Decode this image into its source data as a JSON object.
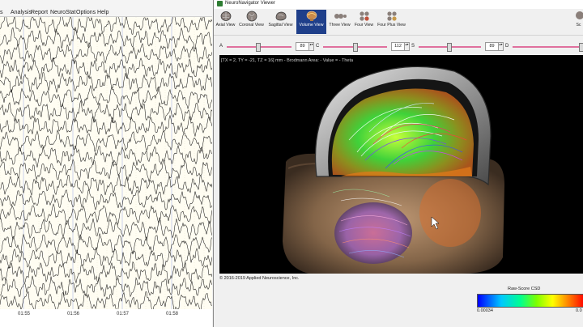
{
  "eeg": {
    "menu": [
      "Analysis",
      "Report",
      "NeuroStat",
      "Options",
      "Help"
    ],
    "menu_partial": "s",
    "time_labels": [
      "01:55",
      "01:56",
      "01:57",
      "01:58"
    ],
    "channel_count": 20,
    "colors": {
      "background": "#fffdf2",
      "trace": "#1a1a1a",
      "gridline": "#a9b8e8"
    }
  },
  "navigator": {
    "title": "NeuroNavigator Viewer",
    "toolbar": [
      {
        "label": "Axial View",
        "icon": "axial-view-icon"
      },
      {
        "label": "Coronal View",
        "icon": "coronal-view-icon"
      },
      {
        "label": "Sagittal View",
        "icon": "sagittal-view-icon"
      },
      {
        "label": "Volume View",
        "icon": "volume-view-icon",
        "active": true
      },
      {
        "label": "Three View",
        "icon": "three-view-icon"
      },
      {
        "label": "Four View",
        "icon": "four-view-icon"
      },
      {
        "label": "Four Plus View",
        "icon": "four-plus-view-icon"
      },
      {
        "label": "Sc",
        "icon": "screenshot-icon"
      }
    ],
    "sliders": [
      {
        "label": "A",
        "value": "89"
      },
      {
        "label": "C",
        "value": "112"
      },
      {
        "label": "S",
        "value": "89"
      },
      {
        "label": "D",
        "value": ""
      }
    ],
    "coords": "[TX = 2, TY = -21, TZ = 16] mm - Brodmann Area:  - Value =  - Theta",
    "copyright": "© 2016-2019 Applied Neuroscience, Inc.",
    "colorbar": {
      "title": "Raw-Score CSD",
      "min": "0.00034",
      "max": "0.0"
    },
    "colors": {
      "active_tab": "#1f3f8a",
      "slider_track": "#e0709e"
    }
  }
}
